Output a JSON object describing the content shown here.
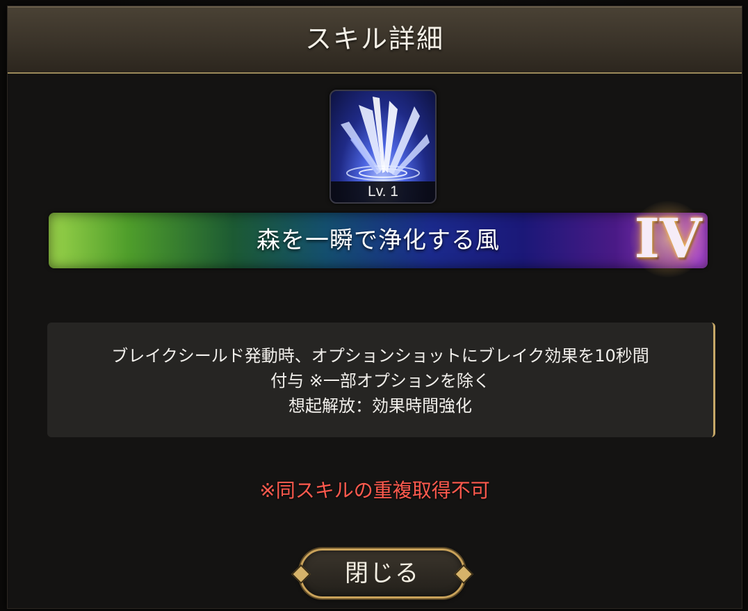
{
  "dialog": {
    "title": "スキル詳細"
  },
  "skill": {
    "icon": "wind-burst-icon",
    "level": "Lv. 1",
    "name": "森を一瞬で浄化する風",
    "rank": "IV",
    "description_lines": [
      "ブレイクシールド発動時、オプションショットにブレイク効果を10秒間",
      "付与 ※一部オプションを除く",
      "想起解放：効果時間強化"
    ]
  },
  "warning": "※同スキルの重複取得不可",
  "buttons": {
    "close": "閉じる"
  },
  "colors": {
    "warning": "#ff5a4e",
    "gold_accent": "#c9a25a"
  }
}
